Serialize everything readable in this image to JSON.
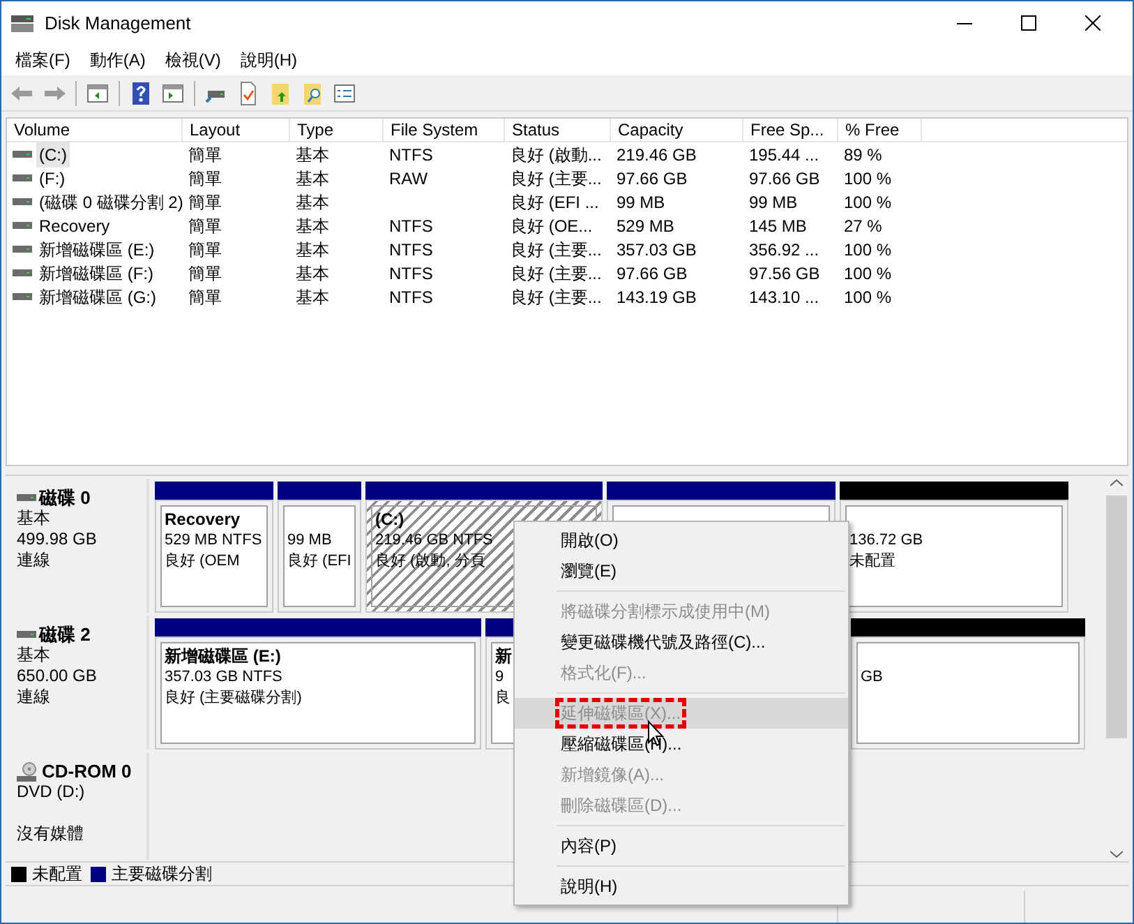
{
  "window": {
    "title": "Disk Management"
  },
  "menu_bar": [
    "檔案(F)",
    "動作(A)",
    "檢視(V)",
    "說明(H)"
  ],
  "table": {
    "columns": [
      "Volume",
      "Layout",
      "Type",
      "File System",
      "Status",
      "Capacity",
      "Free Sp...",
      "% Free"
    ],
    "rows": [
      {
        "selected": true,
        "cells": [
          "(C:)",
          "簡單",
          "基本",
          "NTFS",
          "良好 (啟動...",
          "219.46 GB",
          "195.44 ...",
          "89 %"
        ]
      },
      {
        "selected": false,
        "cells": [
          "(F:)",
          "簡單",
          "基本",
          "RAW",
          "良好 (主要...",
          "97.66 GB",
          "97.66 GB",
          "100 %"
        ]
      },
      {
        "selected": false,
        "cells": [
          "(磁碟 0 磁碟分割 2)",
          "簡單",
          "基本",
          "",
          "良好 (EFI ...",
          "99 MB",
          "99 MB",
          "100 %"
        ]
      },
      {
        "selected": false,
        "cells": [
          "Recovery",
          "簡單",
          "基本",
          "NTFS",
          "良好 (OE...",
          "529 MB",
          "145 MB",
          "27 %"
        ]
      },
      {
        "selected": false,
        "cells": [
          "新增磁碟區 (E:)",
          "簡單",
          "基本",
          "NTFS",
          "良好 (主要...",
          "357.03 GB",
          "356.92 ...",
          "100 %"
        ]
      },
      {
        "selected": false,
        "cells": [
          "新增磁碟區 (F:)",
          "簡單",
          "基本",
          "NTFS",
          "良好 (主要...",
          "97.66 GB",
          "97.56 GB",
          "100 %"
        ]
      },
      {
        "selected": false,
        "cells": [
          "新增磁碟區 (G:)",
          "簡單",
          "基本",
          "NTFS",
          "良好 (主要...",
          "143.19 GB",
          "143.10 ...",
          "100 %"
        ]
      }
    ]
  },
  "disks": [
    {
      "kind": "disk",
      "name": "磁碟 0",
      "lines": [
        "基本",
        "499.98 GB",
        "連線"
      ],
      "partitions": [
        {
          "kind": "primary",
          "selected": false,
          "name": "Recovery",
          "lines": [
            "529 MB NTFS",
            "良好 (OEM"
          ]
        },
        {
          "kind": "primary",
          "selected": false,
          "lines": [
            "99 MB",
            "良好 (EFI"
          ]
        },
        {
          "kind": "primary",
          "selected": true,
          "name": "(C:)",
          "lines": [
            "219.46 GB NTFS",
            "良好 (啟動, 分頁"
          ]
        },
        {
          "kind": "primary",
          "selected": false
        },
        {
          "kind": "unallocated",
          "selected": false,
          "lines": [
            "136.72 GB",
            "未配置"
          ]
        }
      ]
    },
    {
      "kind": "disk",
      "name": "磁碟 2",
      "lines": [
        "基本",
        "650.00 GB",
        "連線"
      ],
      "partitions": [
        {
          "kind": "primary",
          "selected": false,
          "name": "新增磁碟區 (E:)",
          "lines": [
            "357.03 GB NTFS",
            "良好 (主要磁碟分割)"
          ]
        },
        {
          "kind": "primary",
          "selected": false,
          "name": "新",
          "lines": [
            "9",
            "良"
          ]
        },
        {
          "kind": "unallocated",
          "selected": false,
          "lines": [
            "GB"
          ]
        }
      ]
    },
    {
      "kind": "cdrom",
      "name": "CD-ROM 0",
      "lines": [
        "DVD (D:)",
        "沒有媒體"
      ]
    }
  ],
  "legend": [
    {
      "label": "未配置",
      "color": "#000000"
    },
    {
      "label": "主要磁碟分割",
      "color": "#000080"
    }
  ],
  "context_menu": [
    {
      "kind": "item",
      "label": "開啟(O)",
      "disabled": false,
      "selected": false
    },
    {
      "kind": "item",
      "label": "瀏覽(E)",
      "disabled": false,
      "selected": false
    },
    {
      "kind": "separator"
    },
    {
      "kind": "item",
      "label": "將磁碟分割標示成使用中(M)",
      "disabled": true,
      "selected": false
    },
    {
      "kind": "item",
      "label": "變更磁碟機代號及路徑(C)...",
      "disabled": false,
      "selected": false
    },
    {
      "kind": "item",
      "label": "格式化(F)...",
      "disabled": true,
      "selected": false
    },
    {
      "kind": "separator"
    },
    {
      "kind": "item",
      "label": "延伸磁碟區(X)...",
      "disabled": true,
      "selected": true,
      "annotated": true
    },
    {
      "kind": "item",
      "label": "壓縮磁碟區(H)...",
      "disabled": false,
      "selected": false
    },
    {
      "kind": "item",
      "label": "新增鏡像(A)...",
      "disabled": true,
      "selected": false
    },
    {
      "kind": "item",
      "label": "刪除磁碟區(D)...",
      "disabled": true,
      "selected": false
    },
    {
      "kind": "separator"
    },
    {
      "kind": "item",
      "label": "內容(P)",
      "disabled": false,
      "selected": false
    },
    {
      "kind": "separator"
    },
    {
      "kind": "item",
      "label": "說明(H)",
      "disabled": false,
      "selected": false
    }
  ]
}
